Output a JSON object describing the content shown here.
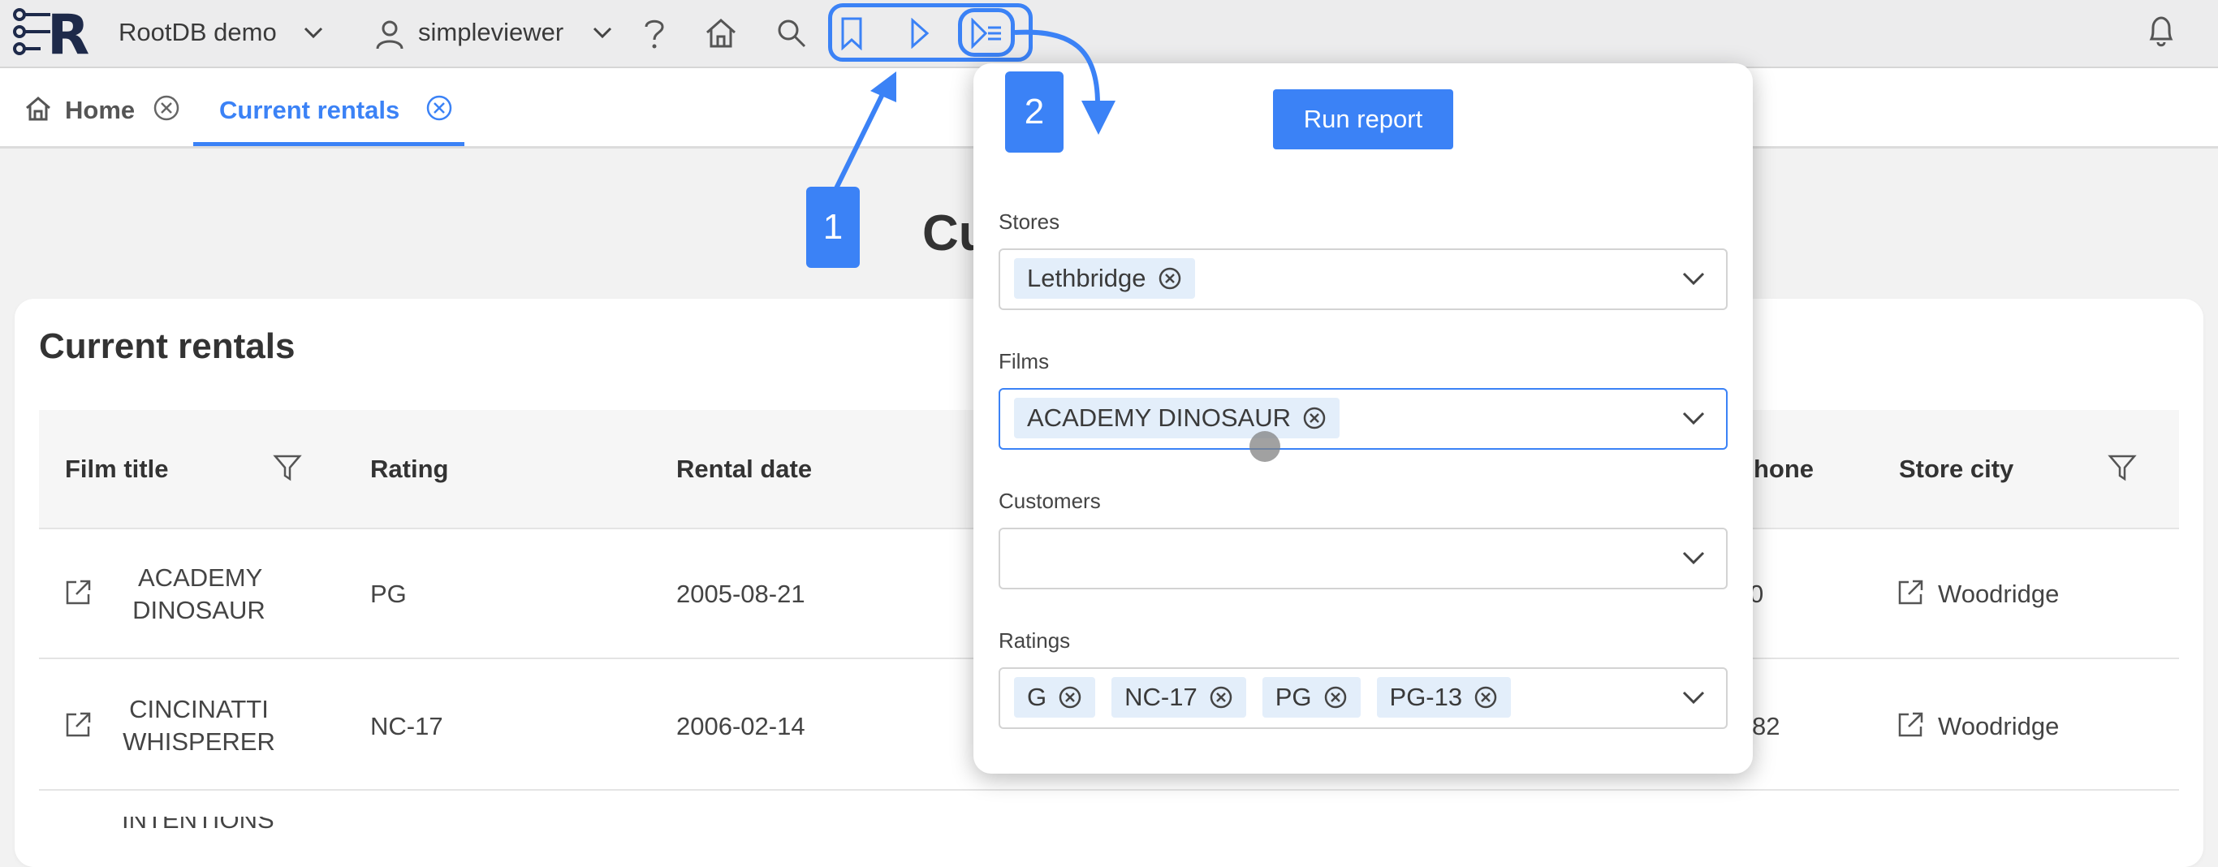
{
  "topbar": {
    "app_name": "RootDB demo",
    "user_name": "simpleviewer"
  },
  "tabs": [
    {
      "label": "Home"
    },
    {
      "label": "Current rentals"
    }
  ],
  "page": {
    "title_partial": "Cu",
    "card_title": "Current rentals"
  },
  "table": {
    "headers": [
      "Film title",
      "Rating",
      "Rental date",
      "hone",
      "Store city"
    ],
    "rows": [
      {
        "film_line1": "ACADEMY",
        "film_line2": "DINOSAUR",
        "rating": "PG",
        "rental_date": "2005-08-21",
        "phone_partial": "0",
        "store_city": "Woodridge"
      },
      {
        "film_line1": "CINCINATTI",
        "film_line2": "WHISPERER",
        "rating": "NC-17",
        "rental_date": "2006-02-14",
        "phone_partial": "82",
        "store_city": "Woodridge"
      },
      {
        "film_line1": "INTENTIONS"
      }
    ]
  },
  "popup": {
    "run_button": "Run report",
    "stores": {
      "label": "Stores",
      "chips": [
        "Lethbridge"
      ]
    },
    "films": {
      "label": "Films",
      "chips": [
        "ACADEMY DINOSAUR"
      ]
    },
    "customers": {
      "label": "Customers",
      "chips": []
    },
    "ratings": {
      "label": "Ratings",
      "chips": [
        "G",
        "NC-17",
        "PG",
        "PG-13"
      ]
    }
  },
  "annotations": {
    "step1": "1",
    "step2": "2"
  },
  "colors": {
    "accent": "#3b82f6",
    "chip_bg": "#e3eefa",
    "topbar_bg": "#ececed",
    "logo": "#1e2a4a"
  },
  "icons": [
    "logo-icon",
    "chevron-down-icon",
    "user-icon",
    "help-icon",
    "home-icon",
    "search-icon",
    "bookmark-icon",
    "play-icon",
    "play-filter-icon",
    "bell-icon",
    "close-circle-icon",
    "filter-icon",
    "external-link-icon"
  ]
}
